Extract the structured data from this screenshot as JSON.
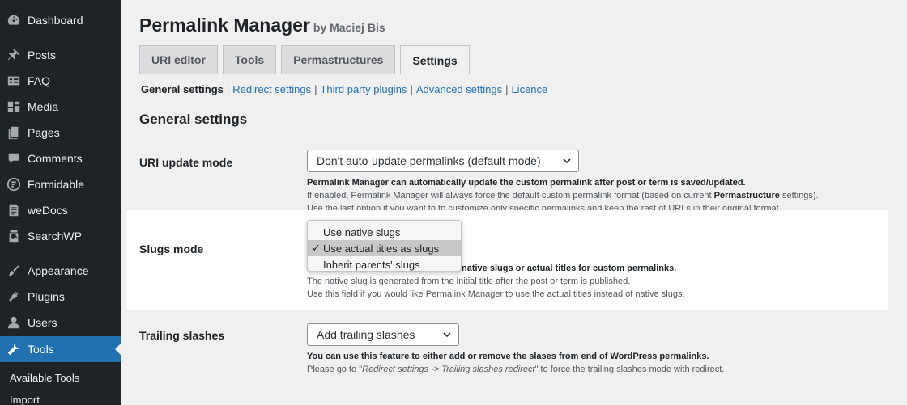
{
  "sidebar": {
    "items": [
      {
        "label": "Dashboard",
        "icon": "dashboard-icon"
      },
      {
        "label": "Posts",
        "icon": "pin-icon"
      },
      {
        "label": "FAQ",
        "icon": "faq-icon"
      },
      {
        "label": "Media",
        "icon": "media-icon"
      },
      {
        "label": "Pages",
        "icon": "pages-icon"
      },
      {
        "label": "Comments",
        "icon": "comment-icon"
      },
      {
        "label": "Formidable",
        "icon": "formidable-icon"
      },
      {
        "label": "weDocs",
        "icon": "document-icon"
      },
      {
        "label": "SearchWP",
        "icon": "searchwp-icon"
      },
      {
        "label": "Appearance",
        "icon": "brush-icon"
      },
      {
        "label": "Plugins",
        "icon": "plug-icon"
      },
      {
        "label": "Users",
        "icon": "user-icon"
      },
      {
        "label": "Tools",
        "icon": "wrench-icon"
      }
    ],
    "submenu": [
      "Available Tools",
      "Import"
    ]
  },
  "header": {
    "title": "Permalink Manager",
    "byline": "by Maciej Bis"
  },
  "tabs": [
    "URI editor",
    "Tools",
    "Permastructures",
    "Settings"
  ],
  "subnav": {
    "current": "General settings",
    "links": [
      "Redirect settings",
      "Third party plugins",
      "Advanced settings",
      "Licence"
    ],
    "separator": "|"
  },
  "section_title": "General settings",
  "uri_update": {
    "label": "URI update mode",
    "value": "Don't auto-update permalinks (default mode)",
    "desc1": "Permalink Manager can automatically update the custom permalink after post or term is saved/updated.",
    "desc2_a": "If enabled, Permalink Manager will always force the default custom permalink format (based on current ",
    "desc2_b": "Permastructure",
    "desc2_c": " settings).",
    "desc3": "Use the last option if you want to to customize only specific permalinks and keep the rest of URLs in their original format."
  },
  "slugs": {
    "label": "Slugs mode",
    "options": [
      "Use native slugs",
      "Use actual titles as slugs",
      "Inherit parents' slugs"
    ],
    "check": "✓",
    "desc1": "native slugs or actual titles for custom permalinks.",
    "desc2": "The native slug is generated from the initial title after the post or term is published.",
    "desc3": "Use this field if you would like Permalink Manager to use the actual titles instead of native slugs."
  },
  "trailing": {
    "label": "Trailing slashes",
    "value": "Add trailing slashes",
    "desc1": "You can use this feature to either add or remove the slases from end of WordPress permalinks.",
    "desc2_a": "Please go to \"",
    "desc2_b": "Redirect settings -> Trailing slashes redirect",
    "desc2_c": "\" to force the trailing slashes mode with redirect."
  },
  "colors": {
    "sidebar_bg": "#1d2327",
    "accent": "#2271b1",
    "link": "#2271b1"
  }
}
